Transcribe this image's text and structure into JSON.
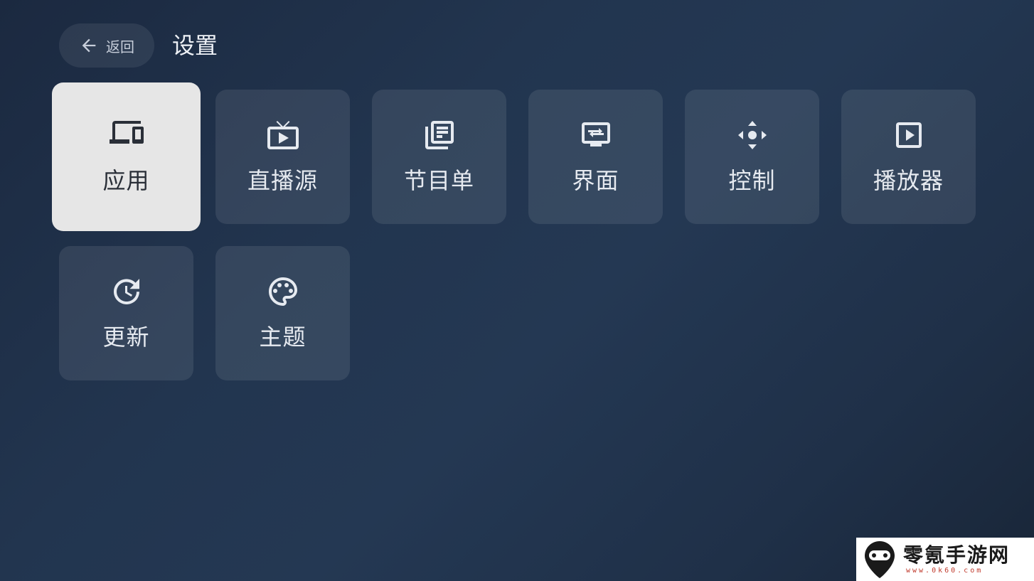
{
  "header": {
    "back_label": "返回",
    "title": "设置"
  },
  "tiles": [
    {
      "label": "应用",
      "icon": "devices-icon",
      "selected": true
    },
    {
      "label": "直播源",
      "icon": "live-tv-icon",
      "selected": false
    },
    {
      "label": "节目单",
      "icon": "library-books-icon",
      "selected": false
    },
    {
      "label": "界面",
      "icon": "display-settings-icon",
      "selected": false
    },
    {
      "label": "控制",
      "icon": "control-dpad-icon",
      "selected": false
    },
    {
      "label": "播放器",
      "icon": "play-box-icon",
      "selected": false
    },
    {
      "label": "更新",
      "icon": "update-icon",
      "selected": false
    },
    {
      "label": "主题",
      "icon": "palette-icon",
      "selected": false
    }
  ],
  "watermark": {
    "name": "零氪手游网",
    "url": "www.0k60.com"
  },
  "colors": {
    "selected_tile": "#e6e6e6",
    "watermark_accent": "#c0392b"
  }
}
